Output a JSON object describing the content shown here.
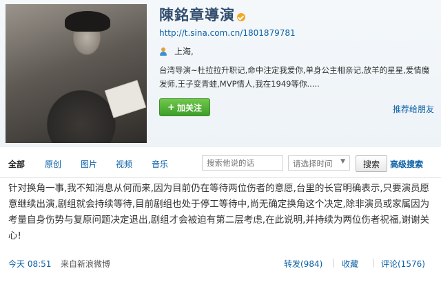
{
  "profile": {
    "name": "陳銘章導演",
    "url": "http://t.sina.com.cn/1801879781",
    "location": "上海,",
    "bio": "台湾导演~杜拉拉升职记,命中注定我爱你,单身公主相亲记,放羊的星星,爱情魔发师,王子变青蛙,MVP情人,我在1949等你.....",
    "follow_label": "加关注",
    "recommend_label": "推荐给朋友",
    "icons": {
      "verified": "verified-badge-icon",
      "location": "user-location-icon",
      "follow": "plus-icon"
    }
  },
  "tabs": [
    {
      "label": "全部",
      "active": true
    },
    {
      "label": "原创"
    },
    {
      "label": "图片"
    },
    {
      "label": "视频"
    },
    {
      "label": "音乐"
    }
  ],
  "search": {
    "placeholder": "搜索他说的话",
    "time_select": "请选择时间",
    "button_label": "搜索",
    "advanced_label": "高级搜索"
  },
  "post": {
    "text": "针对换角一事,我不知消息从何而来,因为目前仍在等待两位伤者的意愿,台里的长官明确表示,只要演员愿意继续出演,剧组就会持续等待,目前剧组也处于停工等待中,尚无确定换角这个决定,除非演员或家属因为考量自身伤势与复原问题决定退出,剧组才会被迫有第二层考虑,在此说明,并持续为两位伤者祝福,谢谢关心!",
    "time": "今天 08:51",
    "source": "来自新浪微博",
    "repost_label": "转发(984)",
    "favorite_label": "收藏",
    "comment_label": "评论(1576)"
  },
  "colors": {
    "link": "#0a5fa6",
    "name": "#334e6e",
    "follow_button": "#4caf32"
  }
}
